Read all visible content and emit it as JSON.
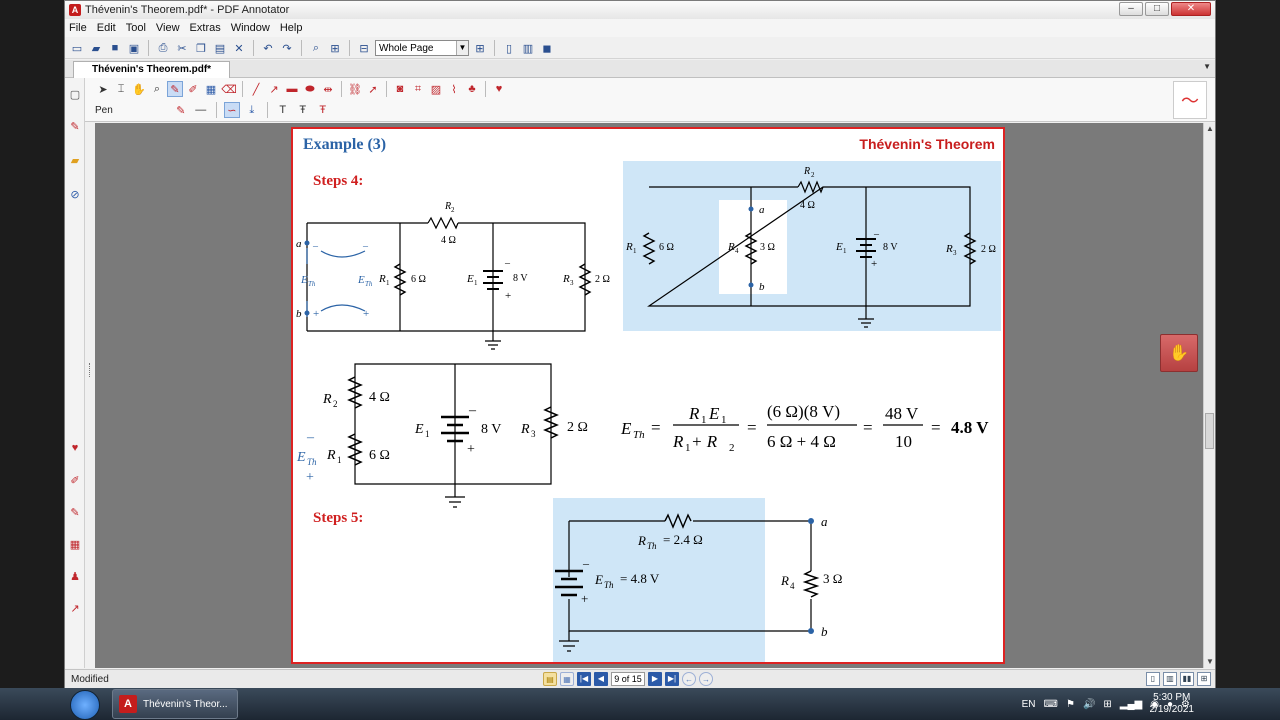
{
  "window": {
    "title": "Thévenin's Theorem.pdf* - PDF Annotator",
    "app_icon": "pdf-annotator-icon",
    "buttons": {
      "minimize": "–",
      "maximize": "□",
      "close": "✕"
    }
  },
  "menu": [
    "File",
    "Edit",
    "Tool",
    "View",
    "Extras",
    "Window",
    "Help"
  ],
  "toolbar": {
    "zoom_value": "Whole Page"
  },
  "tab": {
    "label": "Thévenin's Theorem.pdf*"
  },
  "annot_toolbar": {
    "pen_label": "Pen"
  },
  "page": {
    "example_title": "Example (3)",
    "theorem_title": "Thévenin's Theorem",
    "step4": "Steps 4:",
    "step5": "Steps 5:"
  },
  "circuit1": {
    "R2": "R",
    "R2sub": "2",
    "R2val": "4 Ω",
    "a": "a",
    "b": "b",
    "ETh_left": "E",
    "ETh_sub": "Th",
    "R1": "R",
    "R1sub": "1",
    "R1val": "6 Ω",
    "E1": "E",
    "E1sub": "1",
    "E1val": "8 V",
    "R3": "R",
    "R3sub": "3",
    "R3val": "2 Ω",
    "minus": "–",
    "plus": "+"
  },
  "circuit2": {
    "R2": "R",
    "R2sub": "2",
    "R2val": "4 Ω",
    "R1": "R",
    "R1sub": "1",
    "R1val": "6 Ω",
    "R4": "R",
    "R4sub": "4",
    "R4val": "3 Ω",
    "E1": "E",
    "E1sub": "1",
    "E1val": "8 V",
    "R3": "R",
    "R3sub": "3",
    "R3val": "2 Ω",
    "a": "a",
    "b": "b",
    "minus": "–",
    "plus": "+"
  },
  "circuit3": {
    "R2": "R",
    "R2sub": "2",
    "R2val": "4 Ω",
    "R1": "R",
    "R1sub": "1",
    "R1val": "6 Ω",
    "E1": "E",
    "E1sub": "1",
    "E1val": "8 V",
    "R3": "R",
    "R3sub": "3",
    "R3val": "2 Ω",
    "ETh": "E",
    "EThsub": "Th",
    "minus": "–",
    "plus": "+"
  },
  "equation": {
    "lhs": "E",
    "lhs_sub": "Th",
    "num1": "R",
    "num1_sub1": "1",
    "num1_e": "E",
    "num1_sub2": "1",
    "den1": "R",
    "den1_sub1": "1",
    "den1_plus": " + R",
    "den1_sub2": "2",
    "num2": "(6 Ω)(8 V)",
    "den2": "6 Ω + 4 Ω",
    "num3": "48 V",
    "den3": "10",
    "eq": "=",
    "result": "4.8 V"
  },
  "circuit4": {
    "RTh": "R",
    "RThsub": "Th",
    "RThval": "= 2.4 Ω",
    "ETh": "E",
    "EThsub": "Th",
    "EThval": "= 4.8 V",
    "R4": "R",
    "R4sub": "4",
    "R4val": "3 Ω",
    "a": "a",
    "b": "b",
    "minus": "–",
    "plus": "+"
  },
  "status": {
    "modified": "Modified",
    "page_indicator": "9 of 15"
  },
  "taskbar": {
    "item_label": "Thévenin's Theor...",
    "lang": "EN",
    "time": "5:30 PM",
    "date": "2/19/2021"
  }
}
